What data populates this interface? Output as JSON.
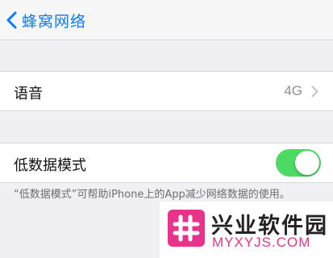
{
  "navbar": {
    "back_label": "蜂窝网络"
  },
  "voice_row": {
    "label": "语音",
    "value": "4G"
  },
  "low_data_row": {
    "label": "低数据模式",
    "toggle_on": true
  },
  "footer_text": "“低数据模式”可帮助iPhone上的App减少网络数据的使用。",
  "watermark": {
    "title": "兴业软件园",
    "subtitle": "MYXYJS.COM"
  },
  "colors": {
    "accent": "#0a7aff",
    "toggle_on": "#4cd964",
    "watermark": "#e8338a"
  },
  "icons": {
    "back": "chevron-left-icon",
    "disclosure": "chevron-right-icon",
    "logo": "hash-logo-icon"
  }
}
